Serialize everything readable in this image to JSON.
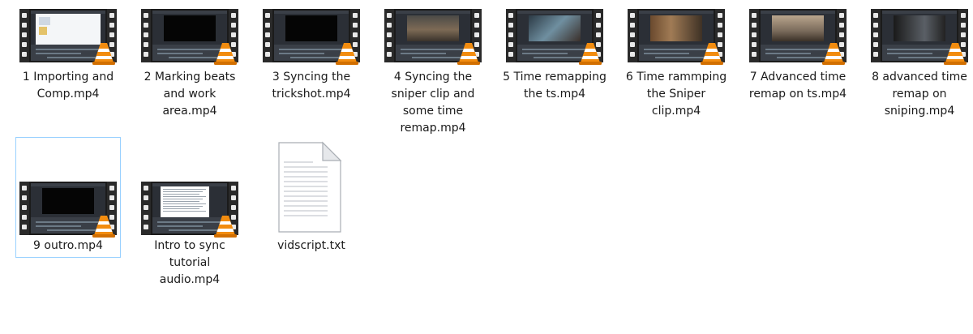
{
  "files": [
    {
      "name": "1 Importing and Comp.mp4",
      "type": "video",
      "thumb": "desktop",
      "selected": false
    },
    {
      "name": "2 Marking beats and work area.mp4",
      "type": "video",
      "thumb": "black",
      "selected": false
    },
    {
      "name": "3 Syncing the trickshot.mp4",
      "type": "video",
      "thumb": "black",
      "selected": false
    },
    {
      "name": "4 Syncing the sniper clip and some time remap.mp4",
      "type": "video",
      "thumb": "game-room",
      "selected": false
    },
    {
      "name": "5 Time remapping the ts.mp4",
      "type": "video",
      "thumb": "game-blue",
      "selected": false
    },
    {
      "name": "6 Time rammping the Sniper clip.mp4",
      "type": "video",
      "thumb": "game-wood",
      "selected": false
    },
    {
      "name": "7 Advanced time remap on ts.mp4",
      "type": "video",
      "thumb": "game-street",
      "selected": false
    },
    {
      "name": "8 advanced time remap on sniping.mp4",
      "type": "video",
      "thumb": "game-dark",
      "selected": false
    },
    {
      "name": "9 outro.mp4",
      "type": "video",
      "thumb": "black",
      "selected": true
    },
    {
      "name": "Intro to sync tutorial audio.mp4",
      "type": "video",
      "thumb": "document",
      "selected": false
    },
    {
      "name": "vidscript.txt",
      "type": "text",
      "thumb": "text-file-icon",
      "selected": false
    }
  ],
  "colors": {
    "selection_border": "#99d1ff",
    "vlc_orange": "#f28c0f",
    "text": "#1a1a1a"
  }
}
